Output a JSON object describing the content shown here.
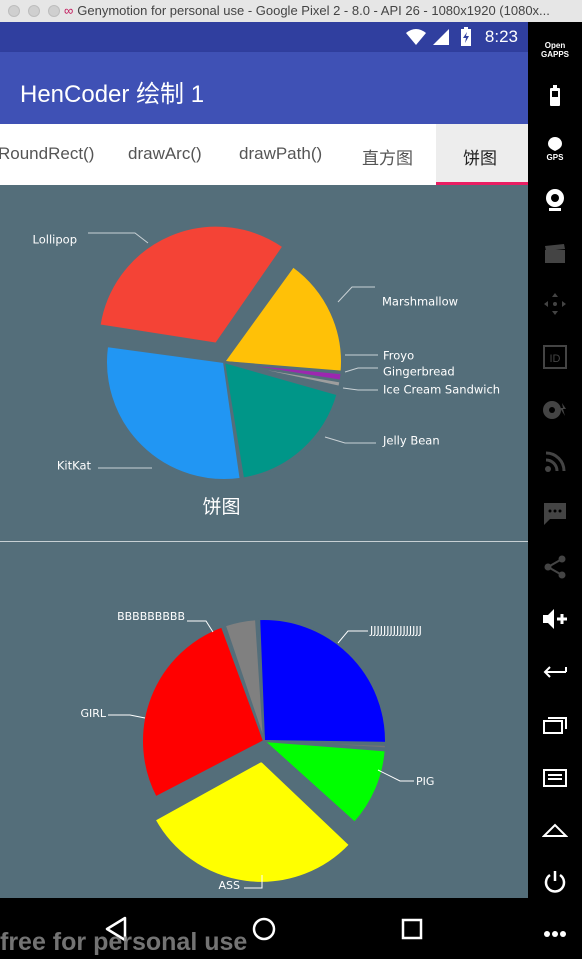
{
  "window": {
    "title": "Genymotion for personal use - Google Pixel 2 - 8.0 - API 26 - 1080x1920 (1080x..."
  },
  "status_bar": {
    "time": "8:23"
  },
  "app_bar": {
    "title": "HenCoder 绘制 1"
  },
  "tabs": [
    {
      "label": "RoundRect()"
    },
    {
      "label": "drawArc()"
    },
    {
      "label": "drawPath()"
    },
    {
      "label": "直方图"
    },
    {
      "label": "饼图",
      "selected": true
    }
  ],
  "chart_data": [
    {
      "type": "pie",
      "title": "饼图",
      "exploded": "Lollipop",
      "slices": [
        {
          "label": "Marshmallow",
          "value": 60,
          "color": "#FFC107"
        },
        {
          "label": "Froyo",
          "value": 4,
          "color": "#9C27B0"
        },
        {
          "label": "Gingerbread",
          "value": 3,
          "color": "#9E9E9E"
        },
        {
          "label": "Ice Cream Sandwich",
          "value": 3,
          "color": "#546E7A"
        },
        {
          "label": "Jelly Bean",
          "value": 66,
          "color": "#009688"
        },
        {
          "label": "KitKat",
          "value": 107,
          "color": "#2196F3"
        },
        {
          "label": "Lollipop",
          "value": 117,
          "color": "#F44336"
        }
      ]
    },
    {
      "type": "pie",
      "exploded": "ASS",
      "slices": [
        {
          "label": "JJJJJJJJJJJJJJJJ",
          "value": 92,
          "color": "#0000FF"
        },
        {
          "label": "",
          "value": 2,
          "color": "#757575"
        },
        {
          "label": "PIG",
          "value": 38,
          "color": "#00FF00"
        },
        {
          "label": "ASS",
          "value": 106,
          "color": "#FFFF00"
        },
        {
          "label": "GIRL",
          "value": 96,
          "color": "#FF0000"
        },
        {
          "label": "BBBBBBBBB",
          "value": 16,
          "color": "#808080"
        }
      ]
    }
  ],
  "watermark": "free for personal use",
  "colors": {
    "app_bar": "#3f51b5",
    "status_bar": "#303f9f",
    "content_bg": "#546e7a",
    "tab_indicator": "#e91e63"
  },
  "toolbar": {
    "open_gapps": "Open GAPPS",
    "tools": [
      "battery-icon",
      "gps-icon",
      "webcam-icon",
      "clapper-icon",
      "dpad-icon",
      "id-icon",
      "media-icon",
      "rss-icon",
      "sms-icon",
      "share-icon",
      "volume-up-icon",
      "back-icon",
      "recents-icon",
      "menu-icon",
      "home-icon",
      "power-icon",
      "more-icon"
    ],
    "gps_label": "GPS",
    "id_label": "ID"
  }
}
